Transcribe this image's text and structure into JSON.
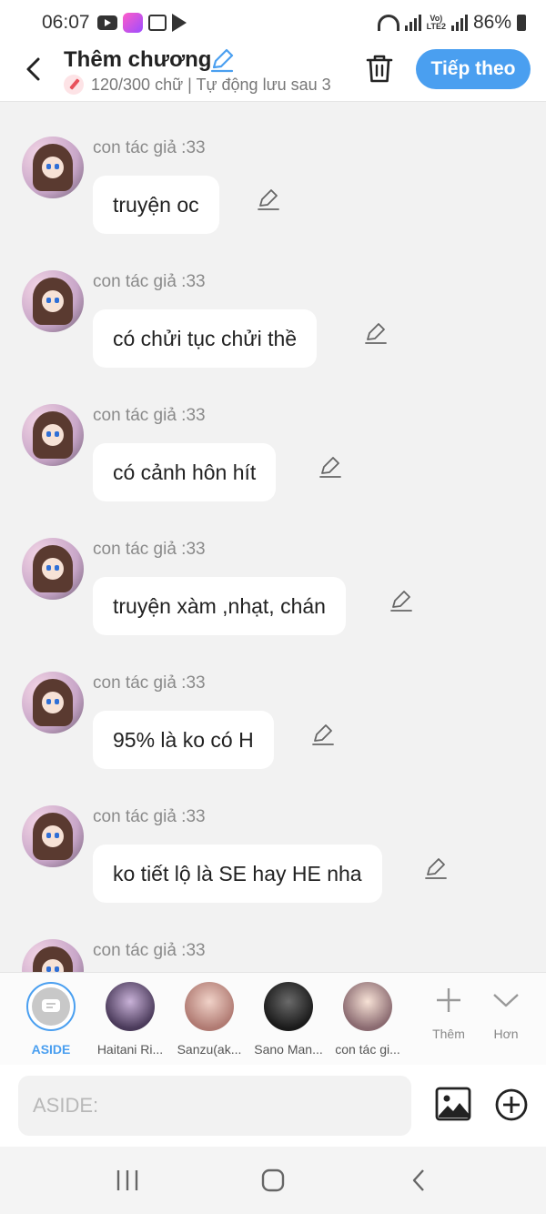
{
  "status_bar": {
    "time": "06:07",
    "network_label": "Vo)\nLTE2",
    "battery": "86%"
  },
  "header": {
    "title": "Thêm chương",
    "subtitle": "120/300 chữ | Tự động lưu sau 3",
    "next_label": "Tiếp theo",
    "back_icon": "chevron-left-icon",
    "trash_icon": "trash-icon"
  },
  "messages": [
    {
      "author": "con tác giả :33",
      "text": "truyện oc"
    },
    {
      "author": "con tác giả :33",
      "text": "có chửi tục chửi thề"
    },
    {
      "author": "con tác giả :33",
      "text": "có cảnh hôn hít"
    },
    {
      "author": "con tác giả :33",
      "text": "truyện xàm ,nhạt, chán"
    },
    {
      "author": "con tác giả :33",
      "text": "95% là ko có H"
    },
    {
      "author": "con tác giả :33",
      "text": "ko tiết lộ là SE hay HE nha"
    },
    {
      "author": "con tác giả :33",
      "text": ""
    }
  ],
  "characters": [
    {
      "label": "ASIDE",
      "active": true
    },
    {
      "label": "Haitani Ri..."
    },
    {
      "label": "Sanzu(ak..."
    },
    {
      "label": "Sano Man..."
    },
    {
      "label": "con tác gi..."
    }
  ],
  "tools": {
    "more_label": "Thêm",
    "expand_label": "Hơn"
  },
  "input": {
    "placeholder": "ASIDE:"
  },
  "colors": {
    "accent": "#4a9ff0",
    "background": "#f2f2f2",
    "bubble": "#ffffff"
  }
}
